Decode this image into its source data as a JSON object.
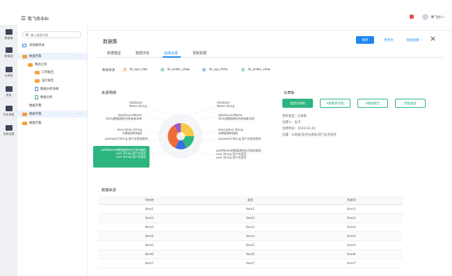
{
  "app": {
    "title": "数飞商业BI",
    "user": "数飞达人"
  },
  "leftnav": [
    {
      "label": "数据集",
      "icon": "database-icon"
    },
    {
      "label": "数据源",
      "icon": "cube-icon"
    },
    {
      "label": "仪表板",
      "icon": "dashboard-icon"
    },
    {
      "label": "报表",
      "icon": "bar-chart-icon"
    },
    {
      "label": "任务调度",
      "icon": "task-icon"
    },
    {
      "label": "系统设置",
      "icon": "settings-icon"
    }
  ],
  "tree": {
    "search_placeholder": "输入搜索内容",
    "add_label": "添加根目录",
    "items": [
      "数据字典",
      "我的订单",
      "订单报告",
      "运行报告",
      "数据分析表格",
      "数据分析",
      "数据字典",
      "数据字典",
      "数据字典"
    ]
  },
  "header": {
    "title": "数据集",
    "save": "保存",
    "save_as": "另存为",
    "more": "快速创建"
  },
  "tabs": [
    "数据模型",
    "数据浏览",
    "血缘关系",
    "更新数据"
  ],
  "sources": {
    "label": "数据来源",
    "items": [
      {
        "badge": "T",
        "name": "bi_sys_role",
        "color": "#f08a24"
      },
      {
        "badge": "V",
        "name": "bi_order_view",
        "color": "#2fb67c"
      },
      {
        "badge": "X",
        "name": "bi_sys_fmts",
        "color": "#3a6fe0"
      },
      {
        "badge": "V",
        "name": "bi_order_view",
        "color": "#2fb67c"
      }
    ]
  },
  "lineage": {
    "title": "来源明细",
    "left": [
      {
        "a": "database",
        "b": "Name String"
      },
      {
        "a": "dataSourceName",
        "b": "String数据源的名称或者名称"
      },
      {
        "a": "description String",
        "b": "存数据源的描述"
      },
      {
        "a": "password String 用户名是加密的"
      },
      {
        "a": "pathName的数据源所在目录的路径",
        "b": "user String 用户名是否",
        "c": "user String 用户名是否"
      }
    ],
    "right": [
      {
        "a": "database",
        "b": "Name String"
      },
      {
        "a": "dataSourceName",
        "b": "String数据源的名称或者名称"
      },
      {
        "a": "description String",
        "b": "存数据源的描述"
      },
      {
        "a": "password String 用户名是加密的"
      },
      {
        "a": "pathName的数据源所在目录的路径",
        "b": "user String 用户名是否",
        "c": "user String 用户名是否"
      }
    ]
  },
  "dashboard": {
    "title": "仪表板",
    "buttons": [
      "运营仪表板",
      "A数据表列图",
      "B数据报告",
      "销售面板"
    ],
    "meta": [
      "更新类型：仪表板",
      "创建人：赵子",
      "创建时间：2020-02-20",
      "位置：仪表板/业务仪表板/部门业务监控"
    ]
  },
  "table": {
    "title": "数据来源",
    "headers": [
      "列名称",
      "类别",
      "列源列"
    ],
    "rows": [
      [
        "Item1",
        "Item1",
        "Item1"
      ],
      [
        "Item2",
        "Item2",
        "Item2"
      ],
      [
        "Item3",
        "Item3",
        "Item3"
      ],
      [
        "Item4",
        "Item4",
        "Item4"
      ],
      [
        "Item5",
        "Item5",
        "Item5"
      ],
      [
        "Item6",
        "Item6",
        "Item6"
      ],
      [
        "Item7",
        "Item7",
        "Item7"
      ]
    ]
  }
}
